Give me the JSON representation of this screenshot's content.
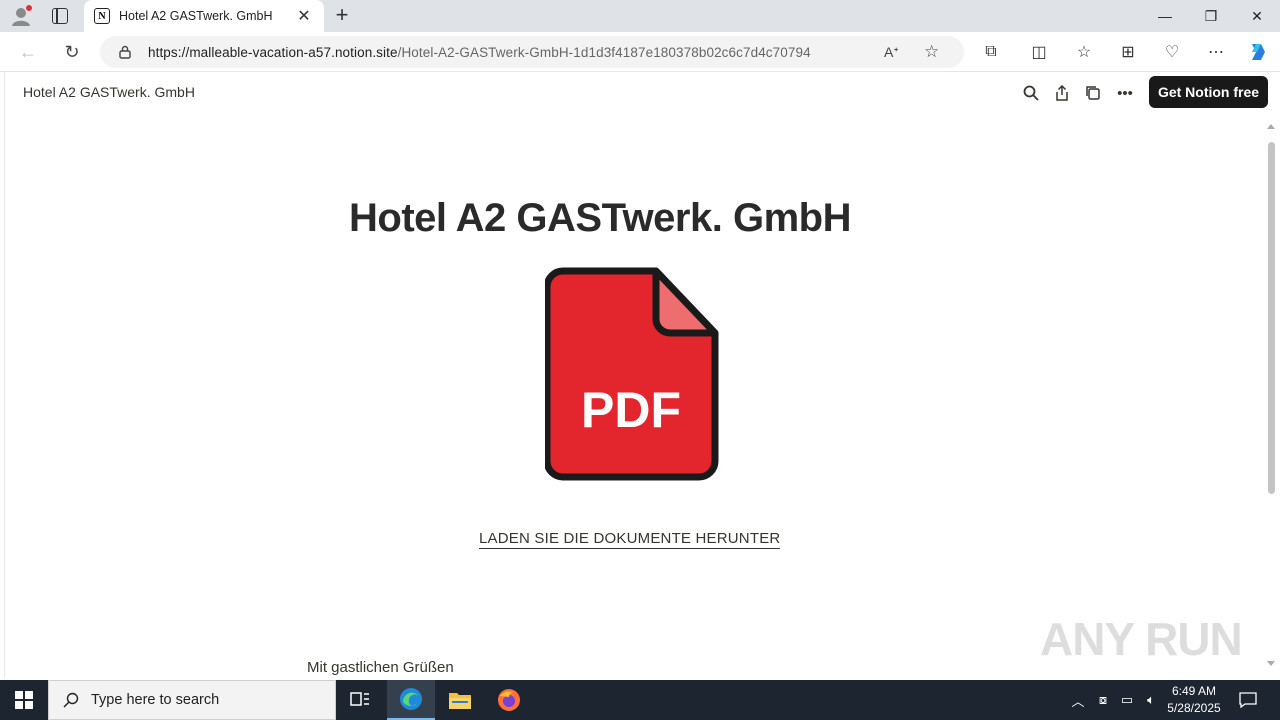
{
  "browser": {
    "tab_title": "Hotel A2 GASTwerk. GmbH",
    "tab_favicon_letter": "N",
    "url_host": "https://malleable-vacation-a57.notion.site",
    "url_path": "/Hotel-A2-GASTwerk-GmbH-1d1d3f4187e180378b02c6c7d4c70794",
    "icons": [
      "profile-icon",
      "tab-groups-icon",
      "back-icon",
      "refresh-icon",
      "lock-icon",
      "read-aloud-icon",
      "favorite-icon",
      "extensions-icon",
      "split-screen-icon",
      "favorites-icon",
      "collections-icon",
      "performance-icon",
      "more-icon",
      "copilot-icon"
    ]
  },
  "notion": {
    "breadcrumb": "Hotel A2 GASTwerk. GmbH",
    "get_notion_label": "Get Notion free",
    "page_title": "Hotel A2 GASTwerk. GmbH",
    "pdf_label": "PDF",
    "download_link": "LADEN SIE DIE DOKUMENTE HERUNTER",
    "greeting": "Mit gastlichen Grüßen",
    "watermark": "ANY RUN",
    "colors": {
      "pdf_red": "#e3262e",
      "pdf_fold": "#ee6d6f",
      "button_bg": "#191919"
    }
  },
  "taskbar": {
    "search_placeholder": "Type here to search",
    "time": "6:49 AM",
    "date": "5/28/2025"
  }
}
